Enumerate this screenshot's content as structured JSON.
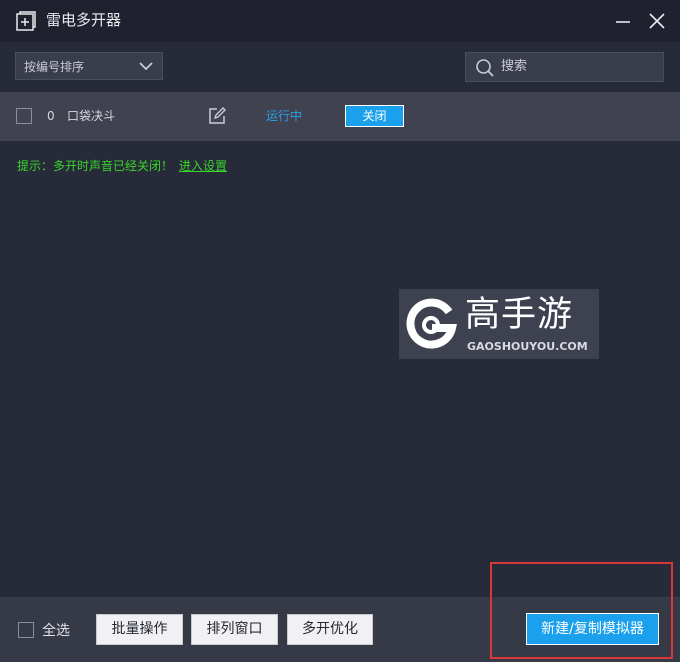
{
  "window": {
    "title": "雷电多开器"
  },
  "toolbar": {
    "sort_label": "按编号排序",
    "search_placeholder": "搜索"
  },
  "instances": [
    {
      "index": "0",
      "name": "口袋决斗",
      "status": "运行中",
      "action_label": "关闭"
    }
  ],
  "hint": {
    "text": "提示：多开时声音已经关闭！",
    "link": "进入设置"
  },
  "watermark": {
    "title": "高手游",
    "subtitle": "GAOSHOUYOU.COM"
  },
  "footer": {
    "select_all_label": "全选",
    "batch_label": "批量操作",
    "arrange_label": "排列窗口",
    "optimize_label": "多开优化",
    "new_copy_label": "新建/复制模拟器"
  },
  "colors": {
    "accent": "#1aa0ec",
    "status": "#2b9fe8",
    "hint": "#38d52a",
    "highlight": "#d9383b"
  }
}
